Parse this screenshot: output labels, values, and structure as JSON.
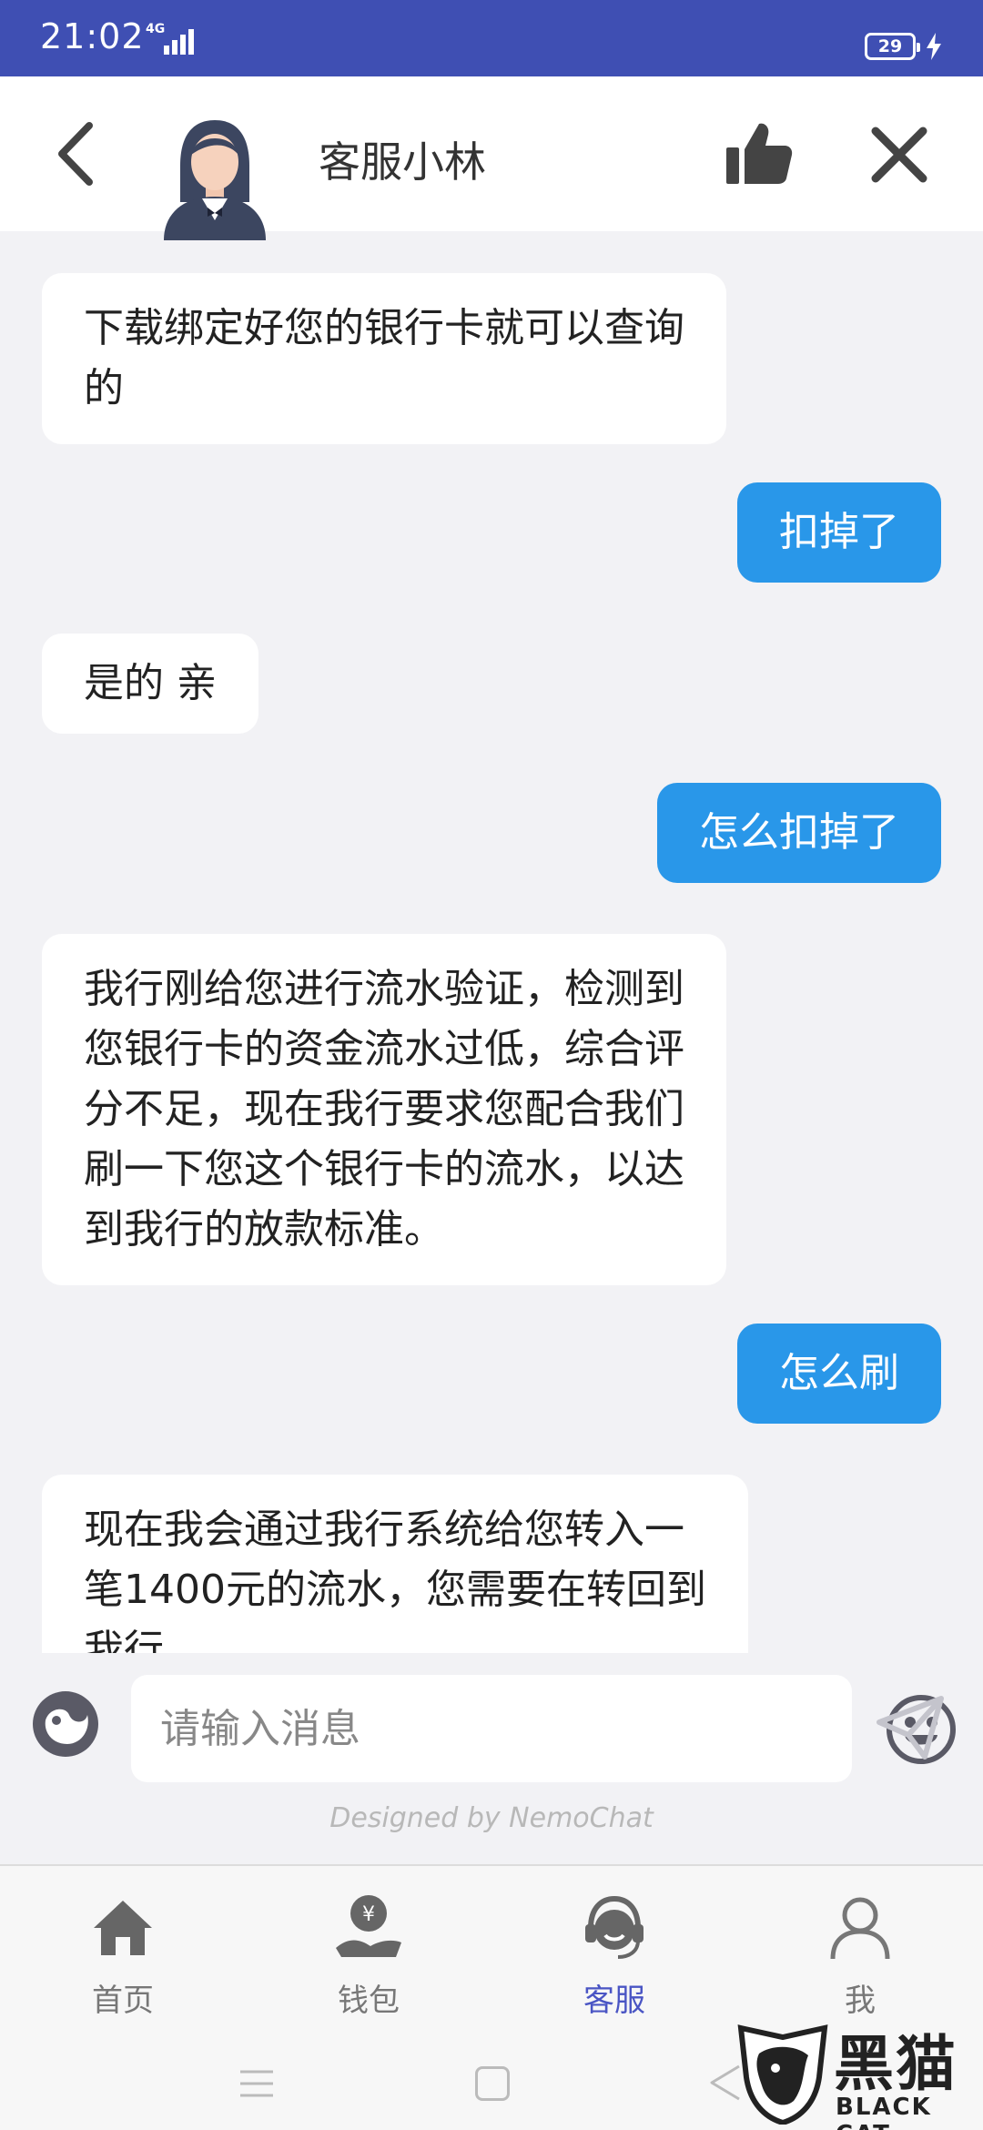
{
  "status_bar": {
    "time": "21:02",
    "network": "4G",
    "battery": "29"
  },
  "header": {
    "agent_name": "客服小林"
  },
  "chat": {
    "messages": [
      {
        "side": "left",
        "text": "下载绑定好您的银行卡就可以查询\n的"
      },
      {
        "side": "right",
        "text": "扣掉了"
      },
      {
        "side": "left",
        "text": "是的 亲"
      },
      {
        "side": "right",
        "text": "怎么扣掉了"
      },
      {
        "side": "left",
        "text": "我行刚给您进行流水验证，检测到\n您银行卡的资金流水过低，综合评\n分不足，现在我行要求您配合我们\n刷一下您这个银行卡的流水，以达\n到我行的放款标准。"
      },
      {
        "side": "right",
        "text": "怎么刷"
      },
      {
        "side": "left",
        "text": "现在我会通过我行系统给您转入一\n笔1400元的流水，您需要在转回到\n我行"
      }
    ]
  },
  "input": {
    "placeholder": "请输入消息"
  },
  "credit": "Designed by NemoChat",
  "bottom_nav": {
    "items": [
      {
        "label": "首页",
        "icon": "home-icon",
        "active": false
      },
      {
        "label": "钱包",
        "icon": "wallet-icon",
        "active": false
      },
      {
        "label": "客服",
        "icon": "customer-service-icon",
        "active": true
      },
      {
        "label": "我",
        "icon": "user-icon",
        "active": false
      }
    ]
  },
  "watermark": {
    "text": "黑猫",
    "sub": "BLACK CAT"
  },
  "colors": {
    "status_bar": "#3f4fb3",
    "bubble_right": "#2997e9",
    "active_nav": "#4a55c4"
  }
}
